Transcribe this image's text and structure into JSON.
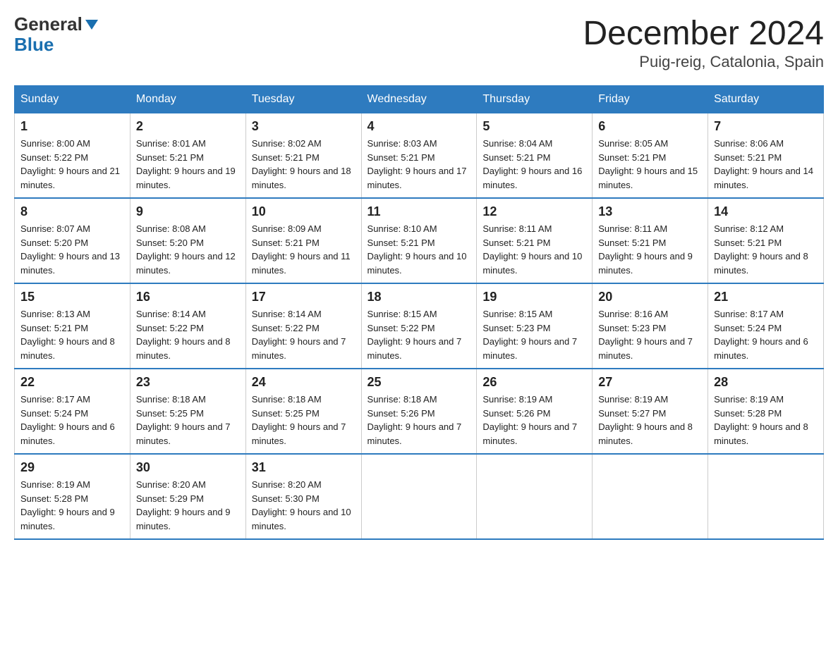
{
  "header": {
    "title": "December 2024",
    "subtitle": "Puig-reig, Catalonia, Spain",
    "logo_general": "General",
    "logo_blue": "Blue"
  },
  "days_of_week": [
    "Sunday",
    "Monday",
    "Tuesday",
    "Wednesday",
    "Thursday",
    "Friday",
    "Saturday"
  ],
  "weeks": [
    [
      {
        "day": "1",
        "sunrise": "8:00 AM",
        "sunset": "5:22 PM",
        "daylight": "9 hours and 21 minutes."
      },
      {
        "day": "2",
        "sunrise": "8:01 AM",
        "sunset": "5:21 PM",
        "daylight": "9 hours and 19 minutes."
      },
      {
        "day": "3",
        "sunrise": "8:02 AM",
        "sunset": "5:21 PM",
        "daylight": "9 hours and 18 minutes."
      },
      {
        "day": "4",
        "sunrise": "8:03 AM",
        "sunset": "5:21 PM",
        "daylight": "9 hours and 17 minutes."
      },
      {
        "day": "5",
        "sunrise": "8:04 AM",
        "sunset": "5:21 PM",
        "daylight": "9 hours and 16 minutes."
      },
      {
        "day": "6",
        "sunrise": "8:05 AM",
        "sunset": "5:21 PM",
        "daylight": "9 hours and 15 minutes."
      },
      {
        "day": "7",
        "sunrise": "8:06 AM",
        "sunset": "5:21 PM",
        "daylight": "9 hours and 14 minutes."
      }
    ],
    [
      {
        "day": "8",
        "sunrise": "8:07 AM",
        "sunset": "5:20 PM",
        "daylight": "9 hours and 13 minutes."
      },
      {
        "day": "9",
        "sunrise": "8:08 AM",
        "sunset": "5:20 PM",
        "daylight": "9 hours and 12 minutes."
      },
      {
        "day": "10",
        "sunrise": "8:09 AM",
        "sunset": "5:21 PM",
        "daylight": "9 hours and 11 minutes."
      },
      {
        "day": "11",
        "sunrise": "8:10 AM",
        "sunset": "5:21 PM",
        "daylight": "9 hours and 10 minutes."
      },
      {
        "day": "12",
        "sunrise": "8:11 AM",
        "sunset": "5:21 PM",
        "daylight": "9 hours and 10 minutes."
      },
      {
        "day": "13",
        "sunrise": "8:11 AM",
        "sunset": "5:21 PM",
        "daylight": "9 hours and 9 minutes."
      },
      {
        "day": "14",
        "sunrise": "8:12 AM",
        "sunset": "5:21 PM",
        "daylight": "9 hours and 8 minutes."
      }
    ],
    [
      {
        "day": "15",
        "sunrise": "8:13 AM",
        "sunset": "5:21 PM",
        "daylight": "9 hours and 8 minutes."
      },
      {
        "day": "16",
        "sunrise": "8:14 AM",
        "sunset": "5:22 PM",
        "daylight": "9 hours and 8 minutes."
      },
      {
        "day": "17",
        "sunrise": "8:14 AM",
        "sunset": "5:22 PM",
        "daylight": "9 hours and 7 minutes."
      },
      {
        "day": "18",
        "sunrise": "8:15 AM",
        "sunset": "5:22 PM",
        "daylight": "9 hours and 7 minutes."
      },
      {
        "day": "19",
        "sunrise": "8:15 AM",
        "sunset": "5:23 PM",
        "daylight": "9 hours and 7 minutes."
      },
      {
        "day": "20",
        "sunrise": "8:16 AM",
        "sunset": "5:23 PM",
        "daylight": "9 hours and 7 minutes."
      },
      {
        "day": "21",
        "sunrise": "8:17 AM",
        "sunset": "5:24 PM",
        "daylight": "9 hours and 6 minutes."
      }
    ],
    [
      {
        "day": "22",
        "sunrise": "8:17 AM",
        "sunset": "5:24 PM",
        "daylight": "9 hours and 6 minutes."
      },
      {
        "day": "23",
        "sunrise": "8:18 AM",
        "sunset": "5:25 PM",
        "daylight": "9 hours and 7 minutes."
      },
      {
        "day": "24",
        "sunrise": "8:18 AM",
        "sunset": "5:25 PM",
        "daylight": "9 hours and 7 minutes."
      },
      {
        "day": "25",
        "sunrise": "8:18 AM",
        "sunset": "5:26 PM",
        "daylight": "9 hours and 7 minutes."
      },
      {
        "day": "26",
        "sunrise": "8:19 AM",
        "sunset": "5:26 PM",
        "daylight": "9 hours and 7 minutes."
      },
      {
        "day": "27",
        "sunrise": "8:19 AM",
        "sunset": "5:27 PM",
        "daylight": "9 hours and 8 minutes."
      },
      {
        "day": "28",
        "sunrise": "8:19 AM",
        "sunset": "5:28 PM",
        "daylight": "9 hours and 8 minutes."
      }
    ],
    [
      {
        "day": "29",
        "sunrise": "8:19 AM",
        "sunset": "5:28 PM",
        "daylight": "9 hours and 9 minutes."
      },
      {
        "day": "30",
        "sunrise": "8:20 AM",
        "sunset": "5:29 PM",
        "daylight": "9 hours and 9 minutes."
      },
      {
        "day": "31",
        "sunrise": "8:20 AM",
        "sunset": "5:30 PM",
        "daylight": "9 hours and 10 minutes."
      },
      null,
      null,
      null,
      null
    ]
  ]
}
